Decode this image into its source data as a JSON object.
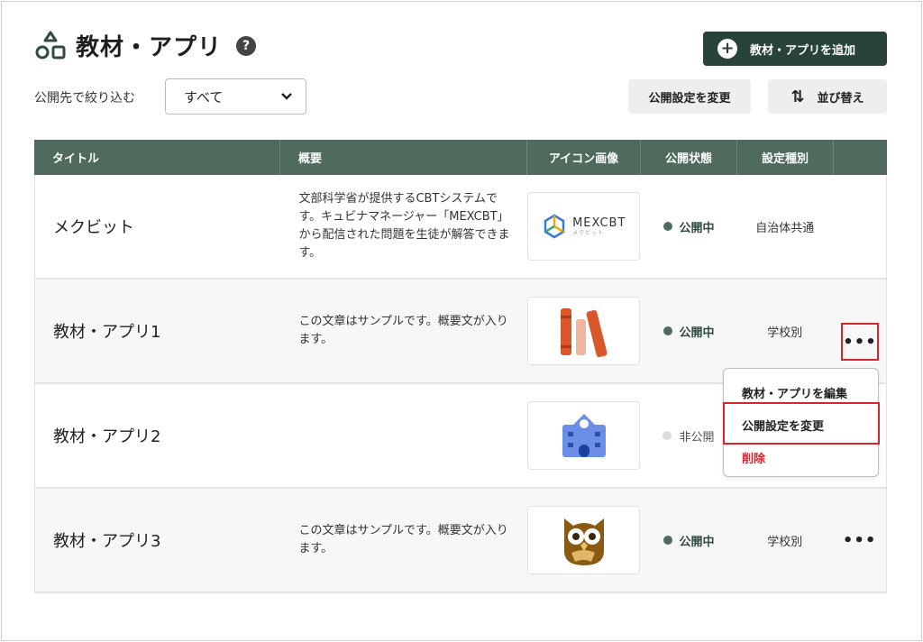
{
  "header": {
    "title": "教材・アプリ",
    "help": "?",
    "add_label": "教材・アプリを追加",
    "add_symbol": "+"
  },
  "filter": {
    "label": "公開先で絞り込む",
    "value": "すべて",
    "chevron": "⌄"
  },
  "toolbar": {
    "publish_label": "公開設定を変更",
    "sort_label": "並び替え",
    "sort_symbol": "⇅"
  },
  "table": {
    "headers": [
      "タイトル",
      "概要",
      "アイコン画像",
      "公開状態",
      "設定種別"
    ],
    "rows": [
      {
        "title": "メクビット",
        "desc": "文部科学省が提供するCBTシステムです。キュビナマネージャー「MEXCBT」から配信された問題を生徒が解答できます。",
        "icon": "mexcbt-logo",
        "status": "公開中",
        "status_on": true,
        "type": "自治体共通"
      },
      {
        "title": "教材・アプリ1",
        "desc": "この文章はサンプルです。概要文が入ります。",
        "icon": "books-icon",
        "status": "公開中",
        "status_on": true,
        "type": "学校別"
      },
      {
        "title": "教材・アプリ2",
        "desc": "",
        "icon": "school-building-icon",
        "status": "非公開",
        "status_on": false,
        "type": ""
      },
      {
        "title": "教材・アプリ3",
        "desc": "この文章はサンプルです。概要文が入ります。",
        "icon": "owl-icon",
        "status": "公開中",
        "status_on": true,
        "type": "学校別"
      }
    ]
  },
  "mexcbt": {
    "name": "MEXCBT",
    "sub": "メクビット"
  },
  "more_label": "•••",
  "menu": {
    "items": [
      "教材・アプリを編集",
      "公開設定を変更",
      "削除"
    ]
  },
  "colors": {
    "primary": "#28433a",
    "header_bg": "#4f6b5d",
    "danger": "#d6252d"
  }
}
